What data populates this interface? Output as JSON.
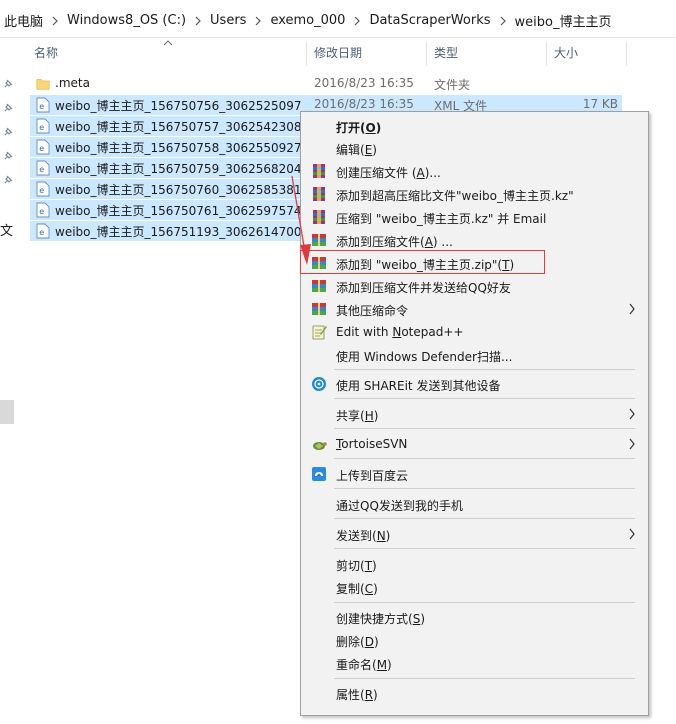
{
  "address": {
    "crumbs": [
      "此电脑",
      "Windows8_OS (C:)",
      "Users",
      "exemo_000",
      "DataScraperWorks",
      "weibo_博主主页"
    ]
  },
  "leftnav": {
    "partial_text": "文"
  },
  "columns": {
    "name": "名称",
    "date": "修改日期",
    "type": "类型",
    "size": "大小"
  },
  "files": [
    {
      "name": ".meta",
      "date": "2016/8/23 16:35",
      "type": "文件夹",
      "size": "",
      "icon": "folder-icon",
      "selected": false
    },
    {
      "name": "weibo_博主主页_156750756_3062525097",
      "date": "2016/8/23 16:35",
      "type": "XML 文件",
      "size": "17 KB",
      "icon": "xml-file-icon",
      "selected": true
    },
    {
      "name": "weibo_博主主页_156750757_3062542308",
      "icon": "xml-file-icon",
      "selected": true
    },
    {
      "name": "weibo_博主主页_156750758_3062550927",
      "icon": "xml-file-icon",
      "selected": true
    },
    {
      "name": "weibo_博主主页_156750759_3062568204",
      "icon": "xml-file-icon",
      "selected": true
    },
    {
      "name": "weibo_博主主页_156750760_3062585381",
      "icon": "xml-file-icon",
      "selected": true
    },
    {
      "name": "weibo_博主主页_156750761_3062597574",
      "icon": "xml-file-icon",
      "selected": true
    },
    {
      "name": "weibo_博主主页_156751193_3062614700",
      "icon": "xml-file-icon",
      "selected": true
    }
  ],
  "menu": {
    "open": {
      "pre": "打开(",
      "key": "O",
      "post": ")"
    },
    "edit": {
      "pre": "编辑(",
      "key": "E",
      "post": ")"
    },
    "create_archive": {
      "pre": "创建压缩文件 (",
      "key": "A",
      "post": ")..."
    },
    "add_kz": "添加到超高压缩比文件\"weibo_博主主页.kz\"",
    "compress_email": "压缩到 \"weibo_博主主页.kz\" 并 Email",
    "add_to_archive": {
      "pre": "添加到压缩文件(",
      "key": "A",
      "post": ") ..."
    },
    "add_zip": {
      "pre": "添加到 \"weibo_博主主页.zip\"(",
      "key": "T",
      "post": ")"
    },
    "add_send_qq": "添加到压缩文件并发送给QQ好友",
    "other_compress": "其他压缩命令",
    "notepad": {
      "pre": "Edit with ",
      "key": "N",
      "post": "otepad++"
    },
    "defender": "使用 Windows Defender扫描...",
    "shareit": "使用 SHAREit 发送到其他设备",
    "share": {
      "pre": "共享(",
      "key": "H",
      "post": ")"
    },
    "tortoise": {
      "pre": "",
      "key": "T",
      "post": "ortoiseSVN"
    },
    "baidu": "上传到百度云",
    "qq_phone": "通过QQ发送到我的手机",
    "send_to": {
      "pre": "发送到(",
      "key": "N",
      "post": ")"
    },
    "cut": {
      "pre": "剪切(",
      "key": "T",
      "post": ")"
    },
    "copy": {
      "pre": "复制(",
      "key": "C",
      "post": ")"
    },
    "shortcut": {
      "pre": "创建快捷方式(",
      "key": "S",
      "post": ")"
    },
    "delete": {
      "pre": "删除(",
      "key": "D",
      "post": ")"
    },
    "rename": {
      "pre": "重命名(",
      "key": "M",
      "post": ")"
    },
    "properties": {
      "pre": "属性(",
      "key": "R",
      "post": ")"
    }
  },
  "colors": {
    "selection": "#cce8ff",
    "highlight_border": "#e0393e",
    "menu_bg": "#f2f2f2"
  }
}
